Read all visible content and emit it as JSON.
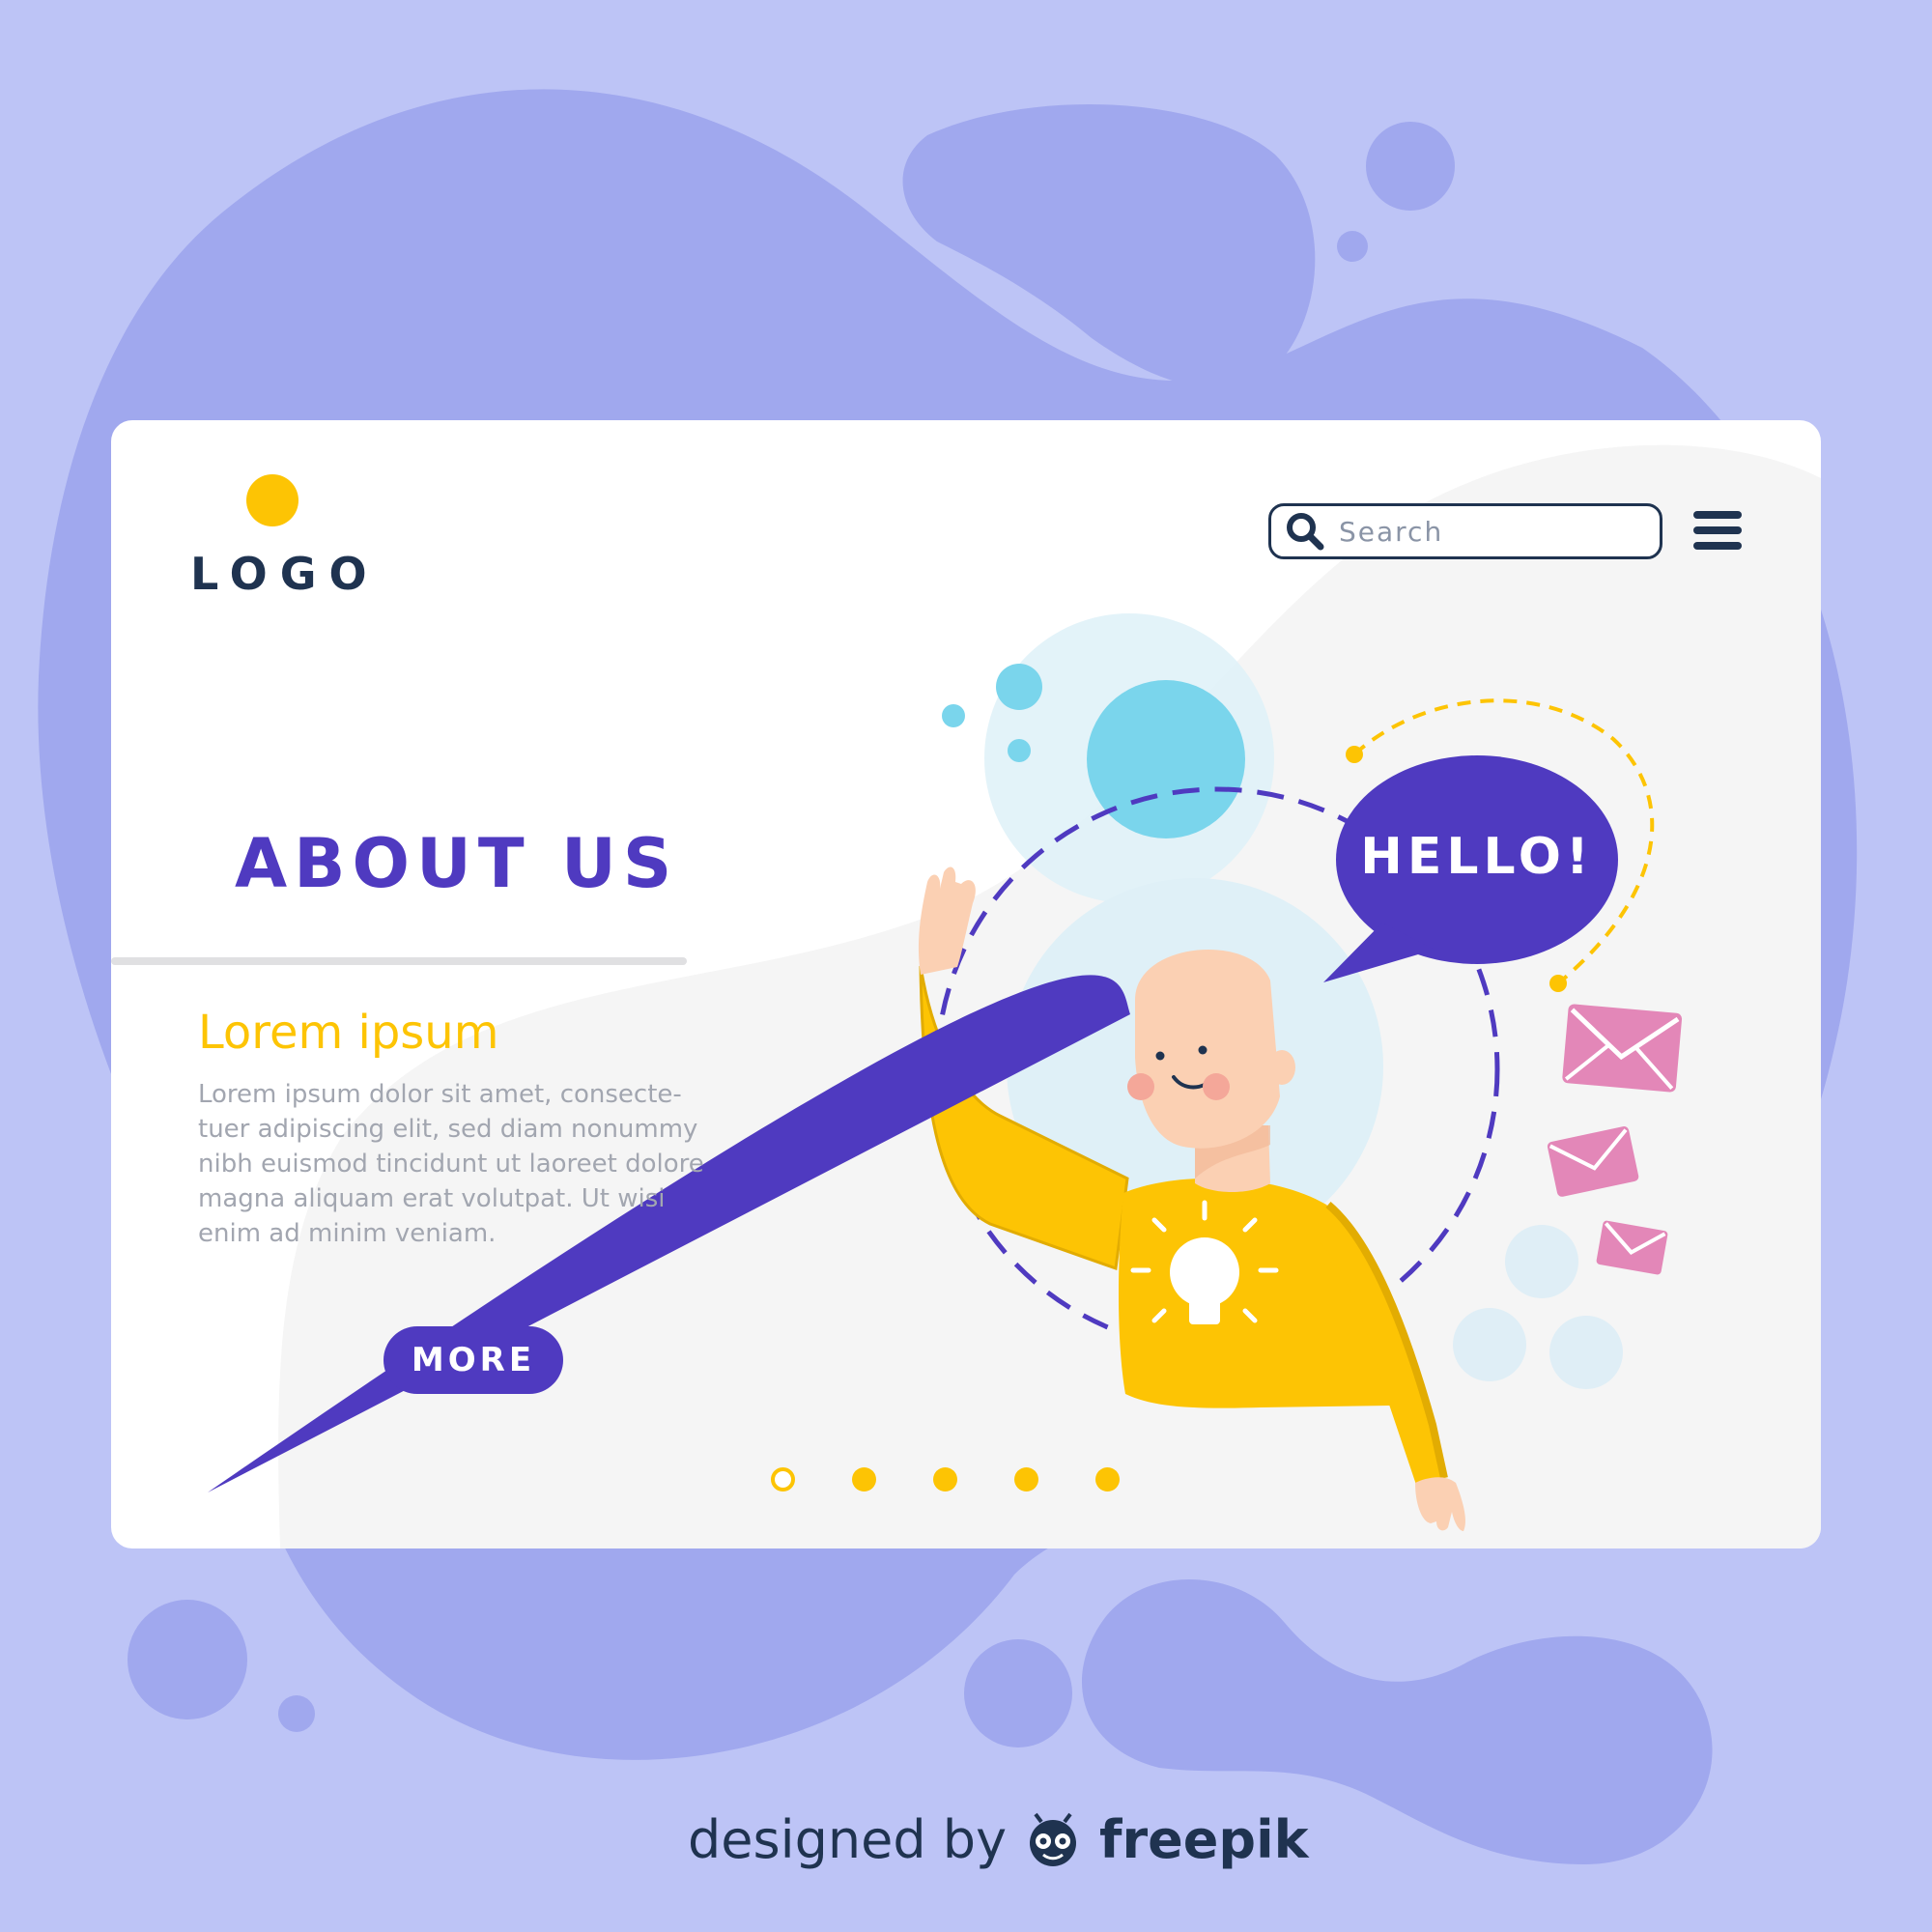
{
  "colors": {
    "background": "#bdc4f6",
    "blob": "#a0a8ee",
    "card": "#ffffff",
    "accent_purple": "#4f3ac0",
    "accent_yellow": "#fdc404",
    "navy": "#1f3350",
    "light_blue": "#7ad5ec",
    "envelope_pink": "#e387b8"
  },
  "header": {
    "logo_text": "LOGO",
    "search_placeholder": "Search",
    "search_icon": "search-icon",
    "menu_icon": "hamburger-menu-icon"
  },
  "hero": {
    "title": "ABOUT US",
    "subtitle": "Lorem ipsum",
    "body": "Lorem ipsum dolor sit amet, consecte-\ntuer adipiscing elit, sed diam nonummy\nnibh euismod tincidunt ut laoreet dolore\nmagna aliquam erat volutpat. Ut wisi\nenim ad minim veniam.",
    "button_label": "MORE"
  },
  "illustration": {
    "speech_bubble_text": "HELLO!",
    "icons": [
      "waving-man-illustration",
      "lightbulb-icon",
      "envelope-icon",
      "speech-bubble-icon"
    ]
  },
  "pagination": {
    "total": 5,
    "active_index": 0
  },
  "footer": {
    "credit_prefix": "designed by",
    "brand": "freepik",
    "brand_icon": "freepik-logo-icon"
  }
}
